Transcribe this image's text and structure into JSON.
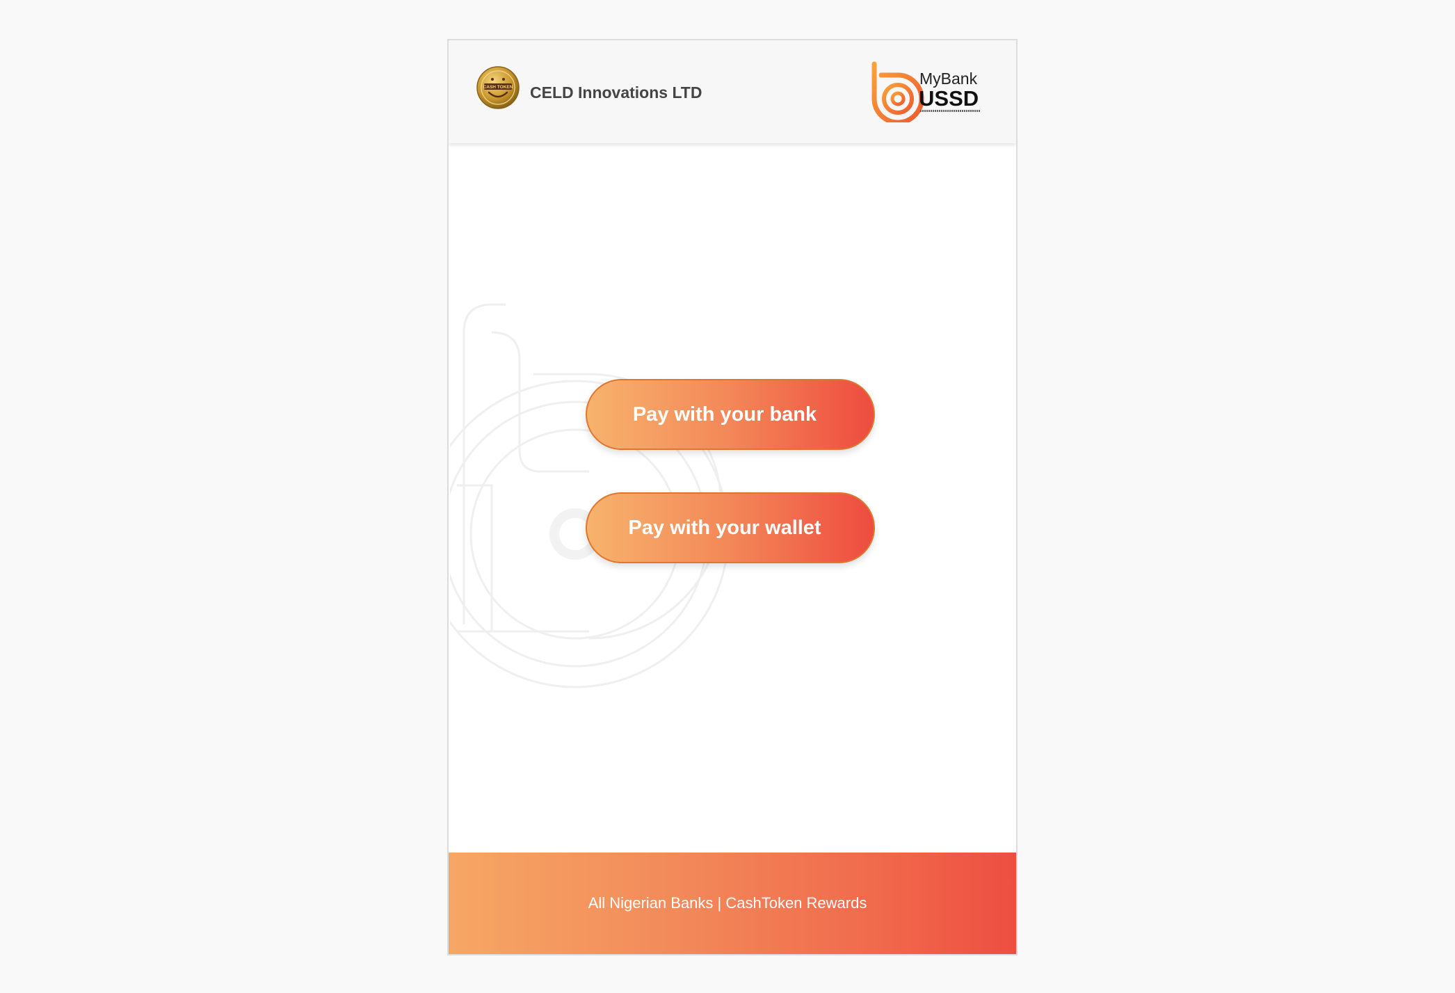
{
  "header": {
    "merchant_logo_text": "CASH TOKEN",
    "merchant_name": "CELD Innovations LTD",
    "brand": {
      "line1": "MyBank",
      "line2": "USSD"
    }
  },
  "actions": {
    "pay_bank_label": "Pay with your bank",
    "pay_wallet_label": "Pay with your wallet"
  },
  "footer": {
    "text": "All Nigerian Banks | CashToken Rewards"
  },
  "colors": {
    "gradient_start": "#f7b36d",
    "gradient_end": "#ee4c3f",
    "button_border": "#e0762e",
    "header_bg": "#f7f7f7",
    "page_bg": "#f9f9f9"
  },
  "icons": {
    "merchant_logo": "cashtoken-coin-icon",
    "brand_logo": "mybank-ussd-logo",
    "watermark": "mybank-b-watermark"
  }
}
